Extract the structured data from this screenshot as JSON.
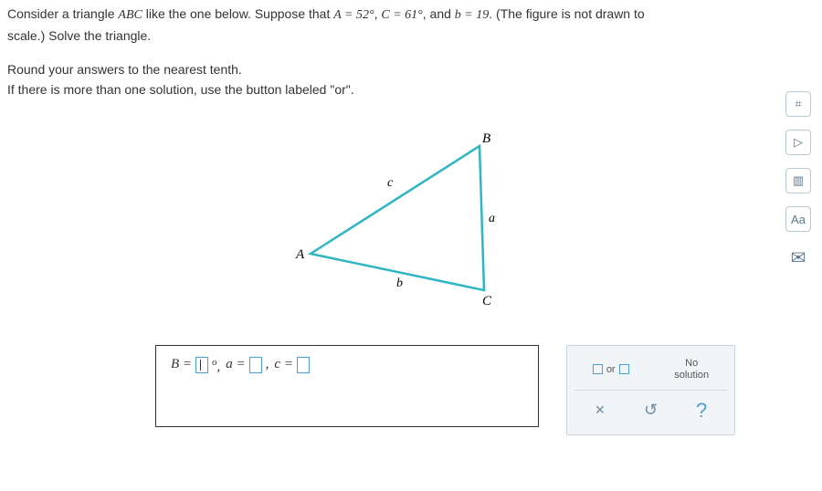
{
  "problem": {
    "line1_pre": "Consider a triangle ",
    "line1_tri": "ABC",
    "line1_mid": " like the one below. Suppose that ",
    "A_eq": "A = 52°",
    "C_eq": "C = 61°",
    "b_eq": "b = 19",
    "line1_post": ". (The figure is not drawn to",
    "line2": "scale.) Solve the triangle.",
    "line3": "Round your answers to the nearest tenth.",
    "line4": "If there is more than one solution, use the button labeled \"or\"."
  },
  "figure": {
    "labels": {
      "A": "A",
      "B": "B",
      "C": "C",
      "a": "a",
      "b": "b",
      "c": "c"
    }
  },
  "answer": {
    "B_label": "B = ",
    "deg_comma": "°, ",
    "a_label": "a = ",
    "comma": ", ",
    "c_label": "c = "
  },
  "tools": {
    "or_word": "or",
    "nosol_l1": "No",
    "nosol_l2": "solution",
    "clear": "×",
    "reset": "↺",
    "help": "?"
  },
  "sidebar": {
    "calc": "⌗",
    "video": "▷",
    "book": "▥",
    "font": "Aa",
    "mail": "✉"
  }
}
